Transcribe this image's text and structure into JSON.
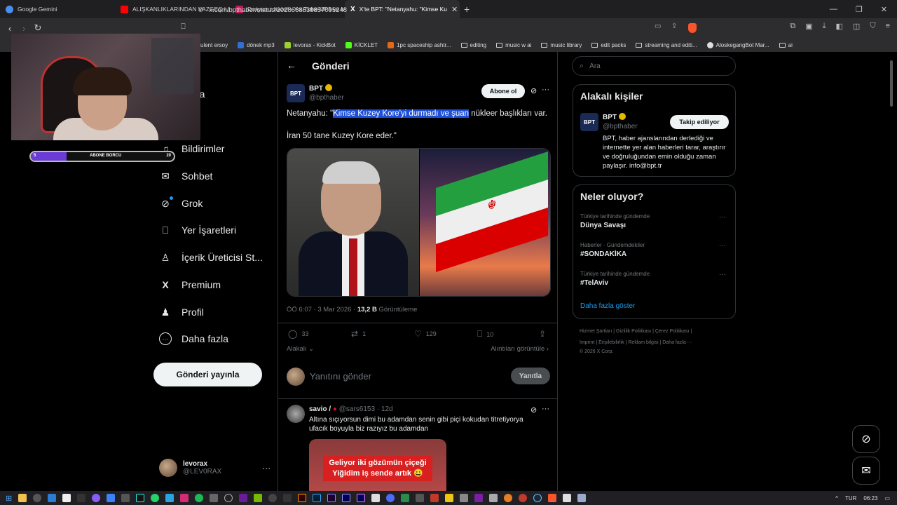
{
  "browser": {
    "tabs": [
      {
        "label": "Google Gemini",
        "color": "#4a8ef0"
      },
      {
        "label": "ALIŞKANLIKLARINDAN VAZGEÇ ! (N",
        "color": "#ff0000"
      },
      {
        "label": "Dosyanız hazır! - YouTube MP3 ve M",
        "color": "#c2185b"
      },
      {
        "label": "X'te BPT: \"Netanyahu: \"Kimse Ku",
        "color": "#ffffff"
      }
    ],
    "url": "x.com/bpthaber/status/2028668538857095248",
    "bookmarks": [
      {
        "label": "ulent ersoy",
        "kind": "folder"
      },
      {
        "label": "dönek mp3",
        "kind": "site",
        "color": "#2f6fd6"
      },
      {
        "label": "levorax - KickBot",
        "kind": "site",
        "color": "#9bd12a"
      },
      {
        "label": "KİCKLET",
        "kind": "site",
        "color": "#53fc18"
      },
      {
        "label": "1pc spaceship ashtr...",
        "kind": "site",
        "color": "#e06a1a"
      },
      {
        "label": "editing",
        "kind": "folder"
      },
      {
        "label": "music w ai",
        "kind": "folder"
      },
      {
        "label": "music library",
        "kind": "folder"
      },
      {
        "label": "edit packs",
        "kind": "folder"
      },
      {
        "label": "streaming and editi...",
        "kind": "folder"
      },
      {
        "label": "AloskegangBot Mar...",
        "kind": "site",
        "color": "#dddddd"
      },
      {
        "label": "ai",
        "kind": "folder"
      }
    ]
  },
  "overlay": {
    "sub_left": "5",
    "sub_label": "ABONE BORCU",
    "sub_right": "20",
    "progress": 0.25
  },
  "nav": {
    "items": [
      {
        "label": "sayfa",
        "icon": "home-icon",
        "glyph": "⌂"
      },
      {
        "label": "et",
        "icon": "search-icon",
        "glyph": "⌕"
      },
      {
        "label": "Bildirimler",
        "icon": "bell-icon",
        "glyph": "🔔"
      },
      {
        "label": "Sohbet",
        "icon": "mail-icon",
        "glyph": "✉"
      },
      {
        "label": "Grok",
        "icon": "grok-icon",
        "glyph": "⊘"
      },
      {
        "label": "Yer İşaretleri",
        "icon": "bookmark-icon",
        "glyph": "🔖"
      },
      {
        "label": "İçerik Üreticisi St...",
        "icon": "creator-icon",
        "glyph": "♙"
      },
      {
        "label": "Premium",
        "icon": "x-logo-icon",
        "glyph": "𝕏"
      },
      {
        "label": "Profil",
        "icon": "person-icon",
        "glyph": "👤"
      },
      {
        "label": "Daha fazla",
        "icon": "more-circle-icon",
        "glyph": "⋯"
      }
    ],
    "post_button": "Gönderi yayınla",
    "account": {
      "name": "levorax",
      "handle": "@LEV0RAX"
    }
  },
  "main": {
    "header": "Gönderi",
    "post": {
      "author": "BPT",
      "handle": "@bpthaber",
      "subscribe": "Abone ol",
      "text_before": "Netanyahu: \"",
      "text_highlight": "Kimse Kuzey Kore'yi durmadı ve şuan",
      "text_after": " nükleer başlıkları var.",
      "text_line2": "İran 50 tane Kuzey Kore eder.\"",
      "time": "ÖÖ 6:07 · 3 Mar 2026 · ",
      "views": "13,2 B",
      "views_label": "Görüntüleme",
      "replies": "33",
      "retweets": "1",
      "likes": "129",
      "bookmarks": "10",
      "relevance": "Alakalı",
      "quotes": "Alıntıları görüntüle"
    },
    "reply_box": {
      "placeholder": "Yanıtını gönder",
      "button": "Yanıtla"
    },
    "comment": {
      "author": "savio /",
      "handle": "@sars6153",
      "age": "· 12d",
      "text": "Altına sıçıyorsun dimi bu adamdan senin gibi piçi kokudan titretiyorya ufacık boyuyla biz razıyız bu adamdan",
      "caption1": "Geliyor iki gözümün çiçeği",
      "caption2": "Yiğidim iş sende artık 😀"
    }
  },
  "right": {
    "search_placeholder": "Ara",
    "people_title": "Alakalı kişiler",
    "person": {
      "name": "BPT",
      "handle": "@bpthaber",
      "follow": "Takip ediliyor",
      "bio": "BPT, haber ajanslarından derlediği ve internette yer alan haberleri tarar, araştırır ve doğruluğundan emin olduğu zaman paylaşır. info@bpt.tr"
    },
    "trends_title": "Neler oluyor?",
    "trends": [
      {
        "context": "Türkiye tarihinde gündemde",
        "name": "Dünya Savaşı"
      },
      {
        "context": "Haberler · Gündemdekiler",
        "name": "#SONDAKİKA"
      },
      {
        "context": "Türkiye tarihinde gündemde",
        "name": "#TelAviv"
      }
    ],
    "show_more": "Daha fazla göster",
    "footer1": "Hizmet Şartları  |  Gizlilik Politikası  |  Çerez Politikası  |",
    "footer2": "Imprint  |  Erişilebilirlik  |  Reklam bilgisi  |  Daha fazla ···",
    "footer3": "© 2026 X Corp."
  },
  "taskbar": {
    "lang": "TUR",
    "time": "06:23"
  }
}
